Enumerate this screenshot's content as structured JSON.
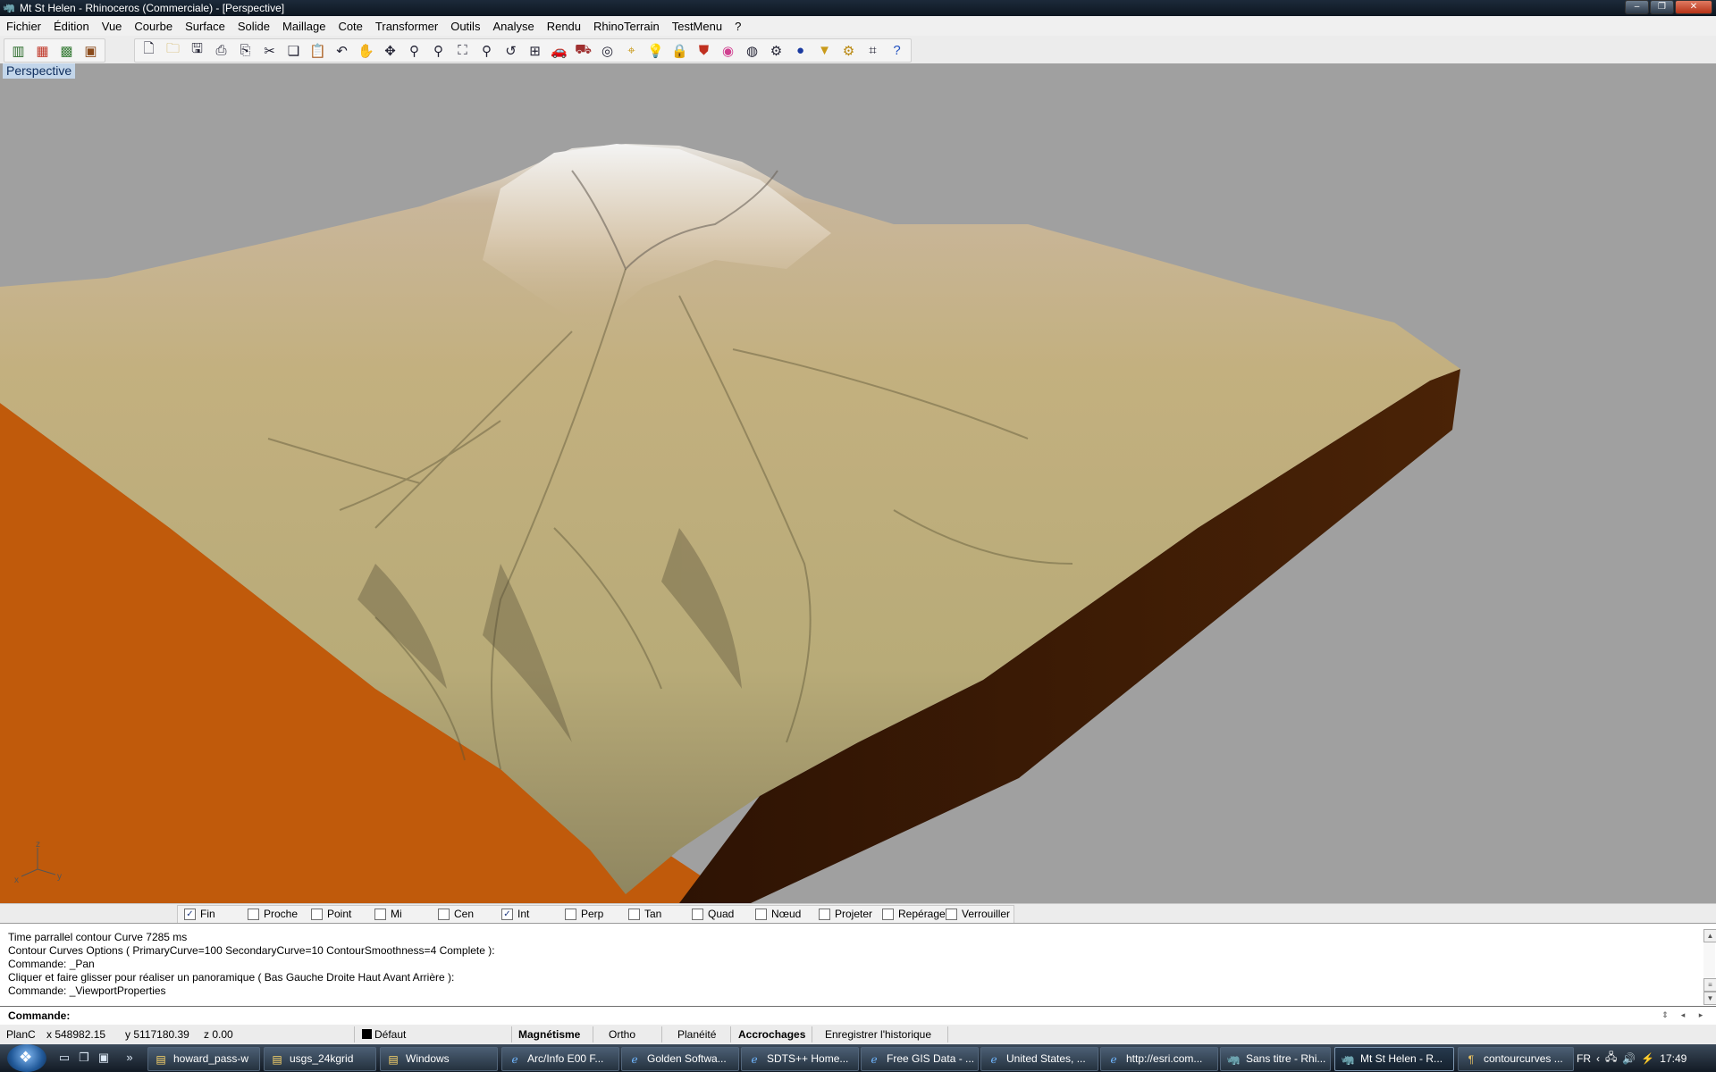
{
  "window": {
    "title": "Mt St Helen - Rhinoceros (Commerciale) - [Perspective]"
  },
  "menu": [
    "Fichier",
    "Édition",
    "Vue",
    "Courbe",
    "Surface",
    "Solide",
    "Maillage",
    "Cote",
    "Transformer",
    "Outils",
    "Analyse",
    "Rendu",
    "RhinoTerrain",
    "TestMenu",
    "?"
  ],
  "toolbar": {
    "group1": [
      "bar-chart-icon",
      "color-grid-icon",
      "map-grid-icon",
      "image-export-icon"
    ],
    "group2": [
      "new-file-icon",
      "open-folder-icon",
      "save-icon",
      "print-icon",
      "import-icon",
      "cut-icon",
      "copy-icon",
      "paste-icon",
      "undo-icon",
      "pan-hand-icon",
      "rotate-view-icon",
      "zoom-dynamic-icon",
      "zoom-window-icon",
      "zoom-extents-icon",
      "zoom-selected-icon",
      "undo-view-icon",
      "four-viewports-icon",
      "car-icon",
      "render-car-icon",
      "circle-target-icon",
      "object-snap-icon",
      "lightbulb-icon",
      "lock-icon",
      "shield-icon",
      "color-wheel-icon",
      "wireframe-sphere-icon",
      "gear-sphere-icon",
      "render-sphere-icon",
      "cone-light-icon",
      "settings-gear-icon",
      "grid-tool-icon",
      "help-icon"
    ]
  },
  "viewport": {
    "label": "Perspective",
    "axes": {
      "z": "z",
      "x": "x",
      "y": "y"
    }
  },
  "osnaps": [
    {
      "label": "Fin",
      "checked": true
    },
    {
      "label": "Proche",
      "checked": false
    },
    {
      "label": "Point",
      "checked": false
    },
    {
      "label": "Mi",
      "checked": false
    },
    {
      "label": "Cen",
      "checked": false
    },
    {
      "label": "Int",
      "checked": true
    },
    {
      "label": "Perp",
      "checked": false
    },
    {
      "label": "Tan",
      "checked": false
    },
    {
      "label": "Quad",
      "checked": false
    },
    {
      "label": "Nœud",
      "checked": false
    },
    {
      "label": "Projeter",
      "checked": false
    },
    {
      "label": "Repéragel",
      "checked": false
    },
    {
      "label": "Verrouiller",
      "checked": false
    }
  ],
  "command_history": [
    "Time  parrallel contour  Curve 7285 ms",
    "Contour Curves Options ( PrimaryCurve=100  SecondaryCurve=10  ContourSmoothness=4  Complete ):",
    "Commande: _Pan",
    "Cliquer et faire glisser pour réaliser un panoramique ( Bas  Gauche  Droite  Haut  Avant  Arrière ):",
    "Commande: _ViewportProperties"
  ],
  "command_prompt": "Commande:",
  "status": {
    "cplane": "PlanC",
    "x": "x 548982.15",
    "y": "y 5117180.39",
    "z": "z 0.00",
    "layer": "Défaut",
    "magnetisme": "Magnétisme",
    "ortho": "Ortho",
    "planeite": "Planéité",
    "accrochages": "Accrochages",
    "historique": "Enregistrer l'historique"
  },
  "taskbar": {
    "tasks": [
      "howard_pass-w",
      "usgs_24kgrid",
      "Windows",
      "Arc/Info E00 F...",
      "Golden Softwa...",
      "SDTS++ Home...",
      "Free GIS Data - ...",
      "United States, ...",
      "http://esri.com...",
      "Sans titre - Rhi...",
      "Mt St Helen - R...",
      "contourcurves ..."
    ],
    "active_task": "Mt St Helen - R...",
    "lang": "FR",
    "clock": "17:49"
  },
  "colors": {
    "viewport_bg": "#a0a0a0",
    "terrain": "#c2b57e",
    "left_face": "#c25a0a",
    "right_face": "#3a1a06",
    "titlebar": "#14202c"
  }
}
